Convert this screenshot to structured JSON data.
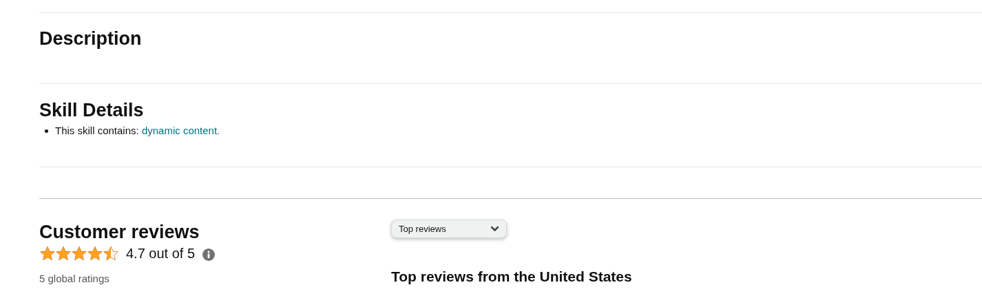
{
  "description": {
    "title": "Description"
  },
  "skill_details": {
    "title": "Skill Details",
    "items": [
      {
        "text": "This skill contains: ",
        "link": "dynamic content."
      }
    ]
  },
  "customer_reviews": {
    "title": "Customer reviews",
    "stars": 4.5,
    "rating": "4.7 out of 5",
    "ratings_count": "5 global ratings"
  },
  "sort": {
    "value": "Top reviews"
  },
  "reviews_heading": "Top reviews from the United States"
}
